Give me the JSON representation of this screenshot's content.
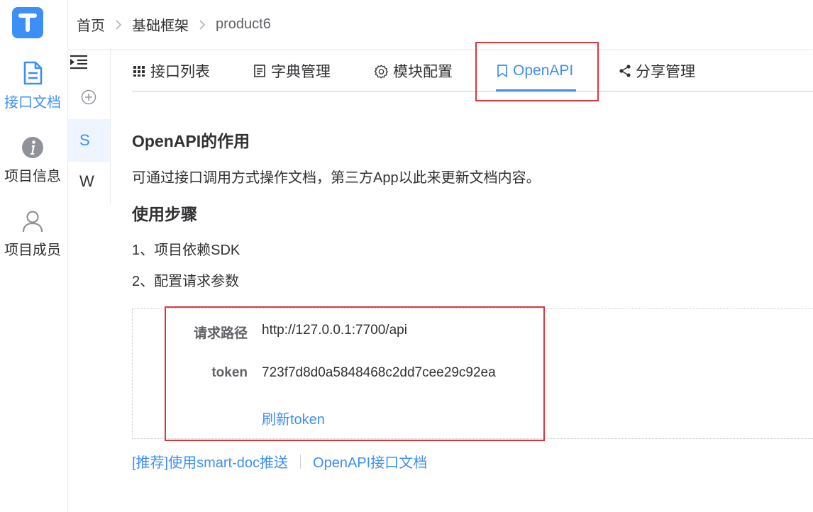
{
  "app": {
    "logo_icon": "letter-t-logo",
    "accent_color": "#3d8ff5"
  },
  "nav": {
    "items": [
      {
        "label": "接口文档",
        "icon": "document-icon",
        "active": true
      },
      {
        "label": "项目信息",
        "icon": "info-icon",
        "active": false
      },
      {
        "label": "项目成员",
        "icon": "user-icon",
        "active": false
      }
    ]
  },
  "breadcrumb": {
    "items": [
      "首页",
      "基础框架",
      "product6"
    ]
  },
  "projects": {
    "items": [
      "S",
      "W"
    ]
  },
  "tabs": [
    {
      "label": "接口列表",
      "icon": "grid-icon"
    },
    {
      "label": "字典管理",
      "icon": "list-doc-icon"
    },
    {
      "label": "模块配置",
      "icon": "gear-icon"
    },
    {
      "label": "OpenAPI",
      "icon": "bookmark-icon",
      "active": true
    },
    {
      "label": "分享管理",
      "icon": "share-icon"
    }
  ],
  "content": {
    "section1_title": "OpenAPI的作用",
    "section1_desc": "可通过接口调用方式操作文档，第三方App以此来更新文档内容。",
    "section2_title": "使用步骤",
    "steps": [
      "1、项目依赖SDK",
      "2、配置请求参数"
    ],
    "params": {
      "url_label": "请求路径",
      "url_value": "http://127.0.0.1:7700/api",
      "token_label": "token",
      "token_value": "723f7d8d0a5848468c2dd7cee29c92ea",
      "refresh_label": "刷新token"
    },
    "links": [
      "[推荐]使用smart-doc推送",
      "OpenAPI接口文档"
    ]
  },
  "highlight_color": "#d9363e"
}
